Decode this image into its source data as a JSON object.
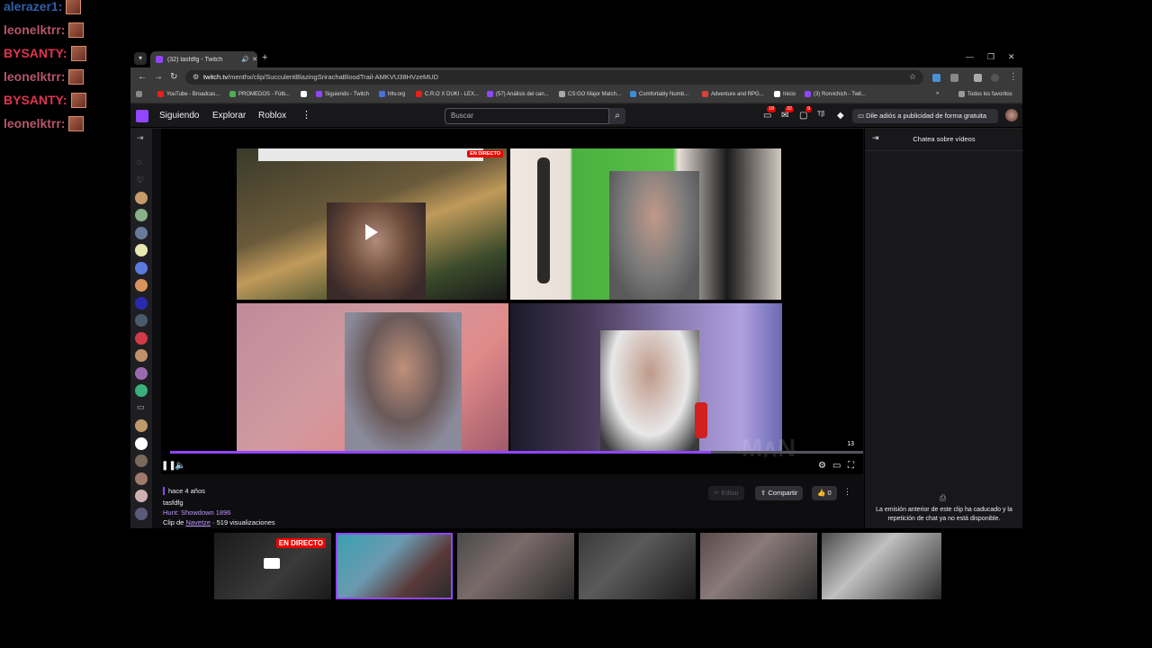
{
  "overlay_chat": [
    {
      "name": "alerazer1:",
      "color": "#2f5fa8"
    },
    {
      "name": "leonelktrr:",
      "color": "#b5576a"
    },
    {
      "name": "BYSANTY:",
      "color": "#e0344d"
    },
    {
      "name": "leonelktrr:",
      "color": "#b5576a"
    },
    {
      "name": "BYSANTY:",
      "color": "#e0344d"
    },
    {
      "name": "leonelktrr:",
      "color": "#b5576a"
    }
  ],
  "browser": {
    "tab_title": "(32) tasfdfg - Twitch",
    "new_tab": "+",
    "url_host": "twitch.tv",
    "url_path": "/menthx/clip/SucculentBlazingSrirachaBloodTrail-AMKVU38HVzeMUD",
    "bookmarks": [
      "YouTube - Broadcas...",
      "PROMEDOS - Fútb...",
      "",
      "Siguiendo - Twitch",
      "hltv.org",
      "C.R.O X DUKI - LEX...",
      "(57) Análisis del can...",
      "CS:GO Major Match...",
      "Comfortably Numb...",
      "Adventure and RPG...",
      "Inicio",
      "(3) Rorvichich - Twit..."
    ],
    "all_bookmarks": "Todos los favoritos"
  },
  "twitch_nav": {
    "following": "Siguiendo",
    "browse": "Explorar",
    "roblox": "Roblox",
    "search_placeholder": "Buscar",
    "badge_1": "18",
    "badge_2": "32",
    "badge_3": "9",
    "ad_free": "Dile adiós a publicidad de forma gratuita"
  },
  "video": {
    "live_label": "EN DIRECTO",
    "viewer_count": "13",
    "progress": 0.78
  },
  "clip_meta": {
    "age": "hace 4 años",
    "title": "tasfdfg",
    "game": "Hunt: Showdown 1896",
    "clip_by_prefix": "Clip de ",
    "clip_by_user": "Navetze",
    "views": " · 519 visualizaciones",
    "edit": "Editar",
    "share": "Compartir",
    "likes": "0"
  },
  "chat_panel": {
    "title": "Chatea sobre vídeos",
    "expired_msg": "La emisión anterior de este clip ha caducado y la repetición de chat ya no está disponible."
  },
  "thumbnails": {
    "live_label": "EN DIRECTO"
  }
}
